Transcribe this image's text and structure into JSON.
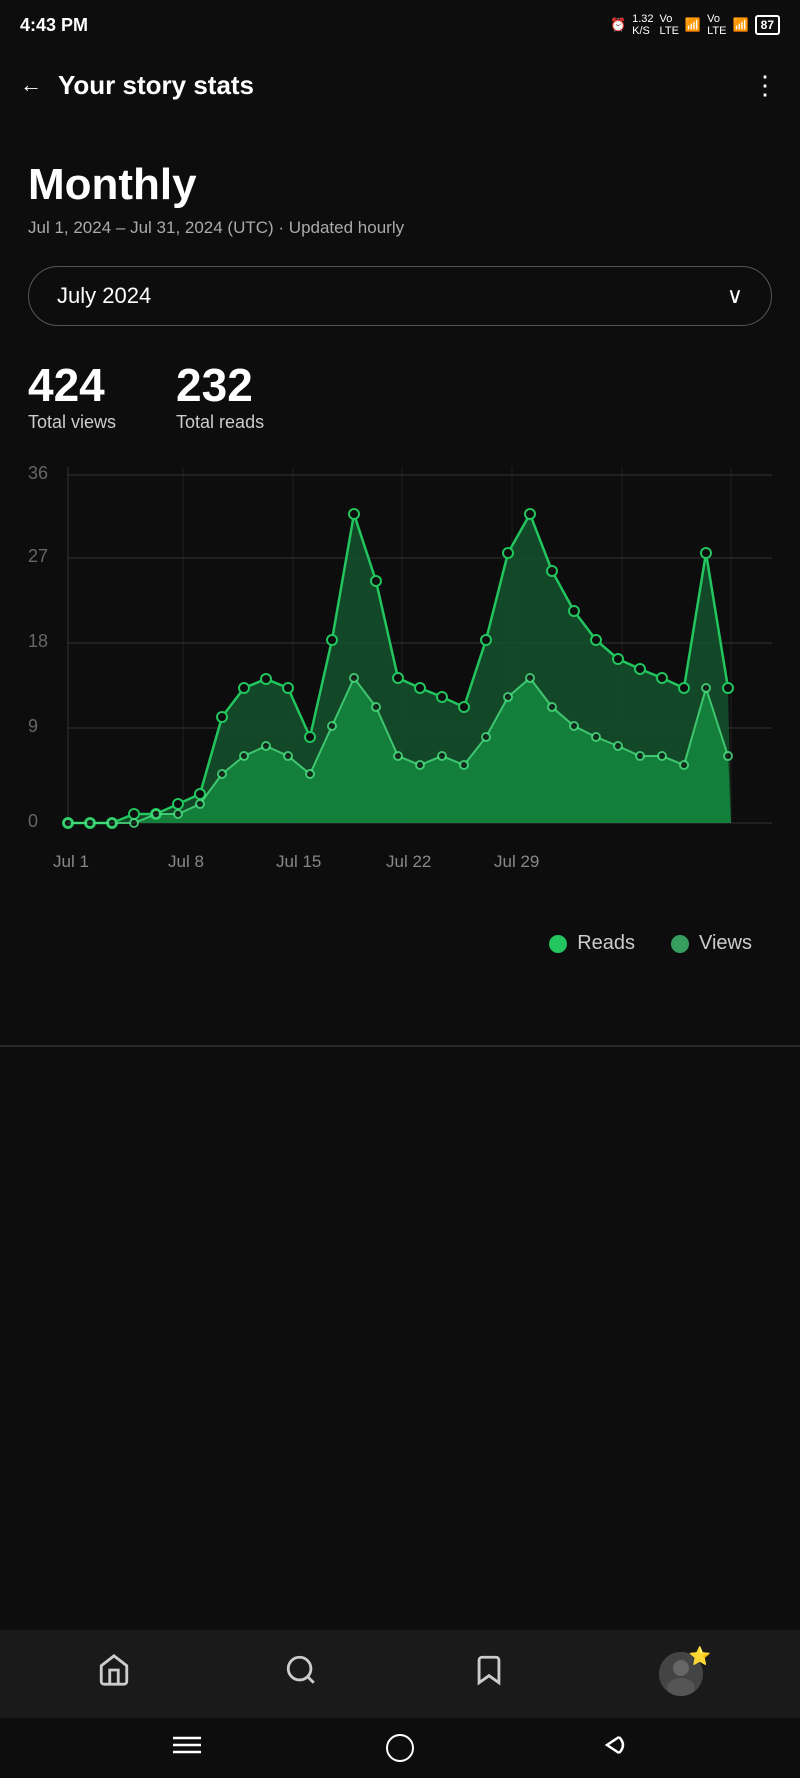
{
  "statusBar": {
    "time": "4:43 PM",
    "battery": "87",
    "network": "4G",
    "kbps": "1.32\nK/S"
  },
  "toolbar": {
    "title": "Your story stats",
    "backLabel": "←",
    "moreLabel": "⋮"
  },
  "content": {
    "periodLabel": "Monthly",
    "periodRange": "Jul 1, 2024 – Jul 31, 2024 (UTC)  ·  Updated hourly",
    "monthSelector": "July 2024",
    "totalViews": "424",
    "totalViewsLabel": "Total views",
    "totalReads": "232",
    "totalReadsLabel": "Total reads"
  },
  "legend": {
    "reads": "Reads",
    "views": "Views"
  },
  "nav": {
    "home": "⌂",
    "search": "⌕",
    "bookmarks": "🔖",
    "star": "⭐"
  },
  "chart": {
    "yLabels": [
      "36",
      "27",
      "18",
      "9",
      "0"
    ],
    "xLabels": [
      "Jul 1",
      "Jul 8",
      "Jul 15",
      "Jul 22",
      "Jul 29"
    ],
    "readsData": [
      0,
      0,
      0,
      1,
      1,
      2,
      3,
      11,
      14,
      15,
      14,
      9,
      19,
      32,
      24,
      15,
      14,
      13,
      12,
      18,
      27,
      33,
      26,
      22,
      18,
      16,
      15,
      13,
      14,
      29,
      16
    ],
    "viewsData": [
      0,
      0,
      0,
      0,
      1,
      1,
      2,
      5,
      7,
      8,
      7,
      5,
      10,
      15,
      12,
      8,
      7,
      7,
      6,
      9,
      13,
      16,
      13,
      11,
      9,
      8,
      7,
      6,
      7,
      14,
      8
    ]
  }
}
